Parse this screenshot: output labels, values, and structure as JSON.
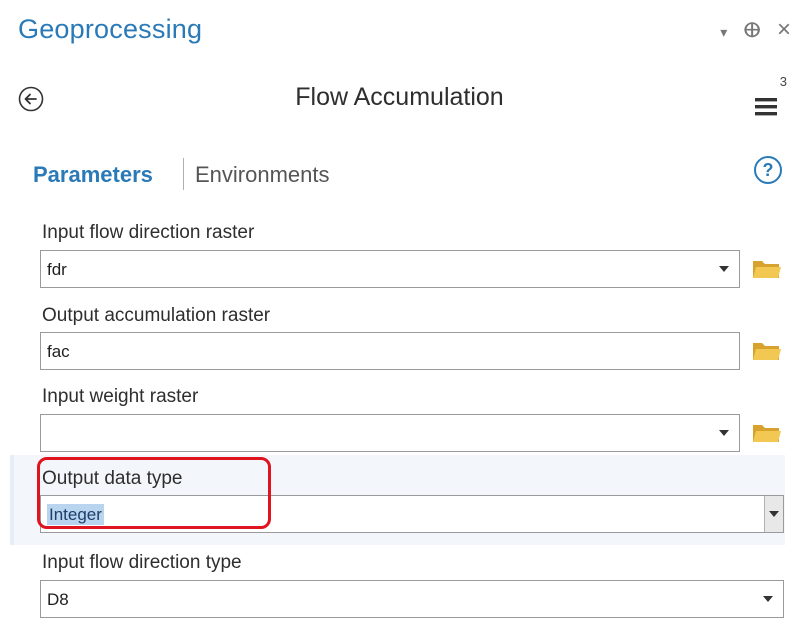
{
  "pane": {
    "title": "Geoprocessing",
    "controls": {
      "menu_icon": "▾",
      "pin_icon": "ⴲ",
      "close_icon": "×"
    }
  },
  "tool": {
    "title": "Flow Accumulation",
    "back_icon": "back-arrow-circle",
    "menu_badge": "3"
  },
  "tabs": {
    "parameters": "Parameters",
    "environments": "Environments"
  },
  "params": [
    {
      "label": "Input flow direction raster",
      "value": "fdr",
      "has_dropdown": true,
      "has_browse": true
    },
    {
      "label": "Output accumulation raster",
      "value": "fac",
      "has_dropdown": false,
      "has_browse": true
    },
    {
      "label": "Input weight raster",
      "value": "",
      "has_dropdown": true,
      "has_browse": true
    },
    {
      "label": "Output data type",
      "value": "Integer",
      "has_dropdown": true,
      "has_browse": false,
      "selected": true
    },
    {
      "label": "Input flow direction type",
      "value": "D8",
      "has_dropdown": true,
      "has_browse": false
    }
  ],
  "colors": {
    "accent": "#2a7ab8",
    "folder": "#e8b83a",
    "highlight": "#e0141e"
  }
}
